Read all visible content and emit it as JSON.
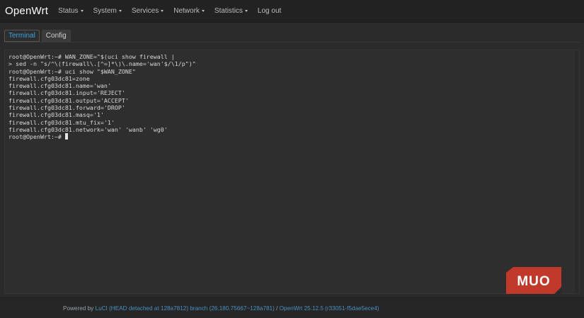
{
  "brand": "OpenWrt",
  "nav": {
    "status": "Status",
    "system": "System",
    "services": "Services",
    "network": "Network",
    "statistics": "Statistics",
    "logout": "Log out"
  },
  "tabs": {
    "terminal": "Terminal",
    "config": "Config"
  },
  "terminal_lines": [
    "root@OpenWrt:~# WAN_ZONE=\"$(uci show firewall |",
    "> sed -n \"s/^\\(firewall\\.[^=]*\\)\\.name='wan'$/\\1/p\")\"",
    "root@OpenWrt:~# uci show \"$WAN_ZONE\"",
    "firewall.cfg03dc81=zone",
    "firewall.cfg03dc81.name='wan'",
    "firewall.cfg03dc81.input='REJECT'",
    "firewall.cfg03dc81.output='ACCEPT'",
    "firewall.cfg03dc81.forward='DROP'",
    "firewall.cfg03dc81.masq='1'",
    "firewall.cfg03dc81.mtu_fix='1'",
    "firewall.cfg03dc81.network='wan' 'wanb' 'wg0'",
    "root@OpenWrt:~# "
  ],
  "footer": {
    "prefix": "Powered by ",
    "luci": "LuCI (HEAD detached at 128a7812) branch (26.180.75667~128a781)",
    "sep": " / ",
    "openwrt": "OpenWrt 25.12.5 (r33051-f5dae5ece4)"
  },
  "logo_text": "MUO",
  "colors": {
    "accent": "#37a4e0",
    "logo_red": "#c0392b",
    "background": "#2b2b2b",
    "navbar": "#222222"
  }
}
